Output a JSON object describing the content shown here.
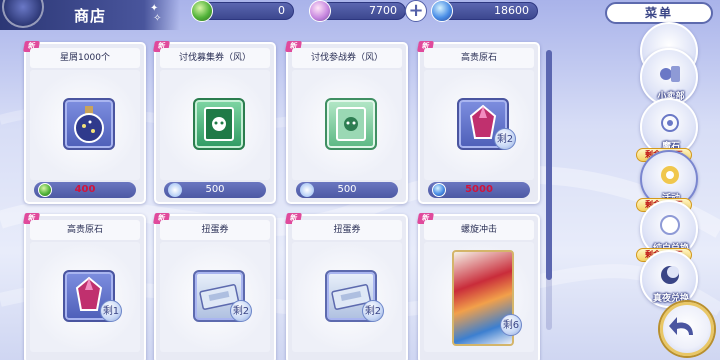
{
  "header": {
    "title": "商店",
    "menu_label": "菜单"
  },
  "currencies": [
    {
      "name": "green-gem",
      "value": "0",
      "color": "#52b33a"
    },
    {
      "name": "star-stone",
      "value": "7700",
      "color": "#c98ae0"
    },
    {
      "name": "blue-orb",
      "value": "18600",
      "color": "#4a8ee6"
    }
  ],
  "shop_items": [
    {
      "title": "星屑1000个",
      "price": "400",
      "price_color": "#d0143c",
      "price_icon": "green-gem-icon",
      "new": true,
      "stock": ""
    },
    {
      "title": "讨伐募集券（风）",
      "price": "500",
      "price_color": "#ffffff",
      "price_icon": "potion-icon",
      "new": true,
      "stock": ""
    },
    {
      "title": "讨伐参战券（风）",
      "price": "500",
      "price_color": "#ffffff",
      "price_icon": "potion-icon",
      "new": true,
      "stock": ""
    },
    {
      "title": "高贵原石",
      "price": "5000",
      "price_color": "#d0143c",
      "price_icon": "blue-orb-icon",
      "new": true,
      "stock": "2"
    },
    {
      "title": "高贵原石",
      "new": true,
      "stock": "1"
    },
    {
      "title": "扭蛋券",
      "new": true,
      "stock": "2"
    },
    {
      "title": "扭蛋券",
      "new": true,
      "stock": "2"
    },
    {
      "title": "螺旋冲击",
      "new": true,
      "stock": "6"
    }
  ],
  "stock_prefix": "剩余",
  "sidebar": [
    {
      "label": "白夜兑换",
      "icon": "white-night-exchange-icon"
    },
    {
      "label": "小卖部",
      "icon": "shop-icon"
    },
    {
      "label": "魔石",
      "icon": "magic-stone-icon"
    },
    {
      "label": "活动",
      "icon": "event-icon",
      "remain": "剩余 27天"
    },
    {
      "label": "纯白兑换",
      "icon": "pure-white-exchange-icon",
      "remain": "剩余 20天"
    },
    {
      "label": "真夜兑换",
      "icon": "true-night-exchange-icon",
      "remain": "剩余 20天"
    }
  ],
  "back_icon": "back-arrow-icon"
}
